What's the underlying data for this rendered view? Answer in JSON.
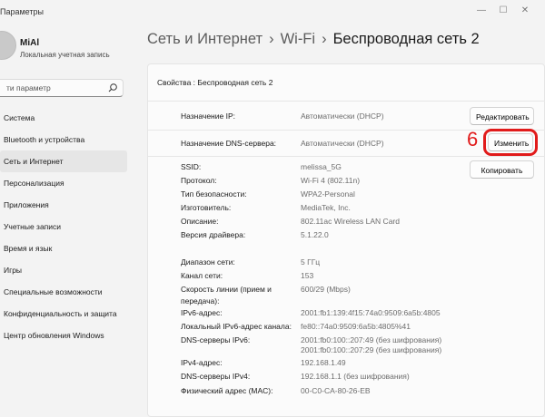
{
  "window": {
    "title": "Параметры",
    "minimize": "—",
    "maximize": "☐",
    "close": "✕"
  },
  "user": {
    "name": "MiAl",
    "account": "Локальная учетная запись"
  },
  "search": {
    "placeholder": "ти параметр"
  },
  "nav": {
    "items": [
      {
        "label": "Система"
      },
      {
        "label": "Bluetooth и устройства"
      },
      {
        "label": "Сеть и Интернет",
        "active": true
      },
      {
        "label": "Персонализация"
      },
      {
        "label": "Приложения"
      },
      {
        "label": "Учетные записи"
      },
      {
        "label": "Время и язык"
      },
      {
        "label": "Игры"
      },
      {
        "label": "Специальные возможности"
      },
      {
        "label": "Конфиденциальность и защита"
      },
      {
        "label": "Центр обновления Windows"
      }
    ]
  },
  "breadcrumb": {
    "part1": "Сеть и Интернет",
    "sep": "›",
    "part2": "Wi-Fi",
    "current": "Беспроводная сеть 2"
  },
  "card": {
    "header": "Свойства : Беспроводная сеть 2",
    "ip": {
      "label": "Назначение IP:",
      "value": "Автоматически (DHCP)",
      "button": "Редактировать"
    },
    "dns": {
      "label": "Назначение DNS-сервера:",
      "value": "Автоматически (DHCP)",
      "button": "Изменить"
    },
    "step_number": "6",
    "props": {
      "ssid": {
        "label": "SSID:",
        "value": "melissa_5G"
      },
      "protocol": {
        "label": "Протокол:",
        "value": "Wi-Fi 4 (802.11n)"
      },
      "security": {
        "label": "Тип безопасности:",
        "value": "WPA2-Personal"
      },
      "manufacturer": {
        "label": "Изготовитель:",
        "value": "MediaTek, Inc."
      },
      "description": {
        "label": "Описание:",
        "value": "802.11ac Wireless LAN Card"
      },
      "driver": {
        "label": "Версия драйвера:",
        "value": "5.1.22.0"
      },
      "band": {
        "label": "Диапазон сети:",
        "value": "5 ГГц"
      },
      "channel": {
        "label": "Канал сети:",
        "value": "153"
      },
      "speed": {
        "label1": "Скорость линии (прием и",
        "label2": "передача):",
        "value": "600/29 (Mbps)"
      },
      "ipv6": {
        "label": "IPv6-адрес:",
        "value": "2001:fb1:139:4f15:74a0:9509:6a5b:4805"
      },
      "linklocal": {
        "label": "Локальный IPv6-адрес канала:",
        "value": "fe80::74a0:9509:6a5b:4805%41"
      },
      "dns6": {
        "label": "DNS-серверы IPv6:",
        "value1": "2001:fb0:100::207:49 (без шифрования)",
        "value2": "2001:fb0:100::207:29 (без шифрования)"
      },
      "ipv4": {
        "label": "IPv4-адрес:",
        "value": "192.168.1.49"
      },
      "dns4": {
        "label": "DNS-серверы IPv4:",
        "value": "192.168.1.1 (без шифрования)"
      },
      "mac": {
        "label": "Физический адрес (MAC):",
        "value": "00-C0-CA-80-26-EB"
      }
    },
    "copy_button": "Копировать"
  }
}
